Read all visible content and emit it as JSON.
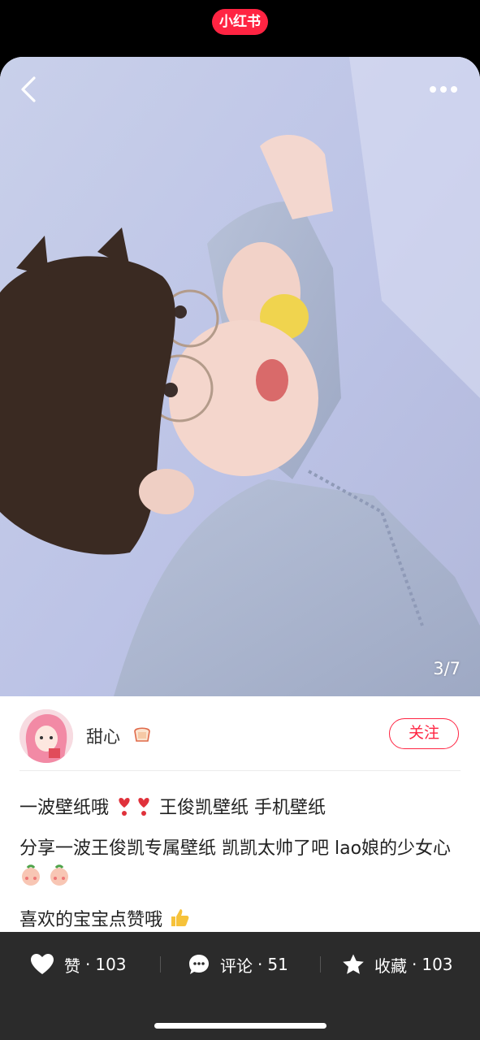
{
  "app": {
    "brand": "小红书",
    "brand_color": "#ff2442"
  },
  "image_viewer": {
    "page_counter": "3/7",
    "back_icon": "chevron-left-icon",
    "more_icon": "more-dots-icon"
  },
  "author": {
    "name": "甜心",
    "badge_icon": "toast-bread-icon",
    "follow_label": "关注"
  },
  "post": {
    "title": "一波壁纸哦❣️❣️王俊凯壁纸 手机壁纸",
    "title_part1": "一波壁纸哦",
    "title_part2": "王俊凯壁纸  手机壁纸",
    "desc_text": "分享一波王俊凯专属壁纸   凯凯太帅了吧  lao娘的少女心",
    "footer_text": "喜欢的宝宝点赞哦"
  },
  "actions": {
    "like": {
      "label": "赞",
      "count": "103",
      "icon": "heart-icon"
    },
    "comment": {
      "label": "评论",
      "count": "51",
      "icon": "comment-bubble-icon"
    },
    "collect": {
      "label": "收藏",
      "count": "103",
      "icon": "star-icon"
    }
  },
  "colors": {
    "action_bar_bg": "#2b2b2b",
    "follow_border": "#ff2442"
  }
}
